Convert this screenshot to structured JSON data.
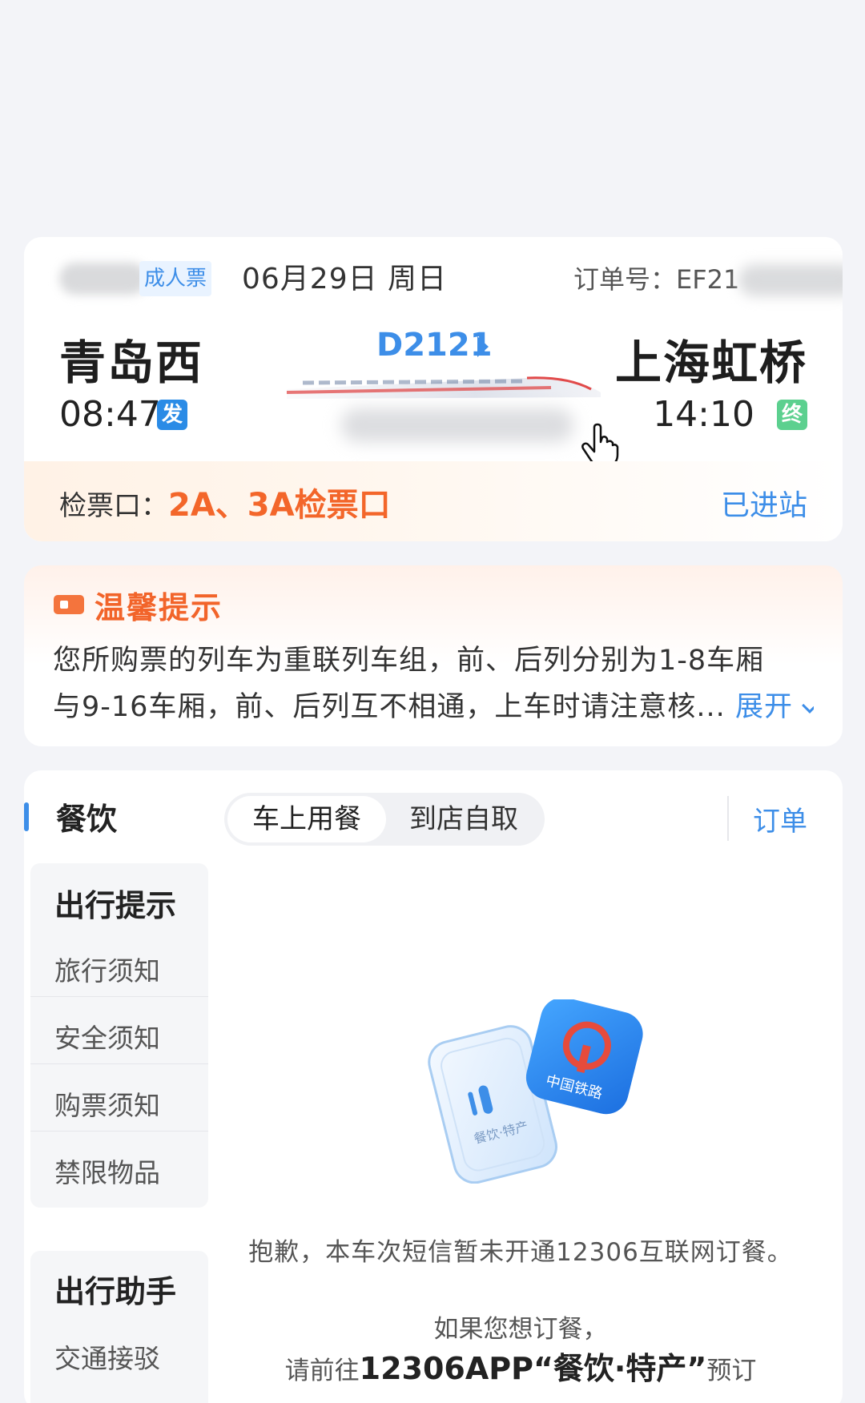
{
  "ticket": {
    "type_label": "成人票",
    "date": "06月29日 周日",
    "order_label": "订单号：EF21",
    "from_station": "青岛西",
    "to_station": "上海虹桥",
    "train_no": "D2121",
    "dep_time": "08:47",
    "dep_badge": "发",
    "arr_time": "14:10",
    "arr_badge": "终",
    "gate_label": "检票口：",
    "gate_value": "2A、3A检票口",
    "status": "已进站"
  },
  "tip": {
    "title": "温馨提示",
    "line1": "您所购票的列车为重联列车组，前、后列分别为1-8车厢",
    "line2": "与9-16车厢，前、后列互不相通，上车时请注意核...",
    "expand_label": "展开"
  },
  "service": {
    "active_section": "餐饮",
    "group1_heading": "出行提示",
    "group1_items": [
      "旅行须知",
      "安全须知",
      "购票须知",
      "禁限物品"
    ],
    "group2_heading": "出行助手",
    "group2_items": [
      "交通接驳"
    ],
    "tabs": [
      "车上用餐",
      "到店自取"
    ],
    "orders_label": "订单",
    "empty_message": "抱歉，本车次短信暂未开通12306互联网订餐。",
    "hint_line1": "如果您想订餐，",
    "hint_prefix": "请前往",
    "hint_strong": "12306APP“餐饮·特产”",
    "hint_suffix": "预订",
    "illustration_left_text": "餐饮·特产",
    "illustration_right_text": "中国铁路"
  },
  "colors": {
    "accent_blue": "#3d8ee8",
    "accent_orange": "#f3662a",
    "arrival_green": "#5cd08f"
  }
}
